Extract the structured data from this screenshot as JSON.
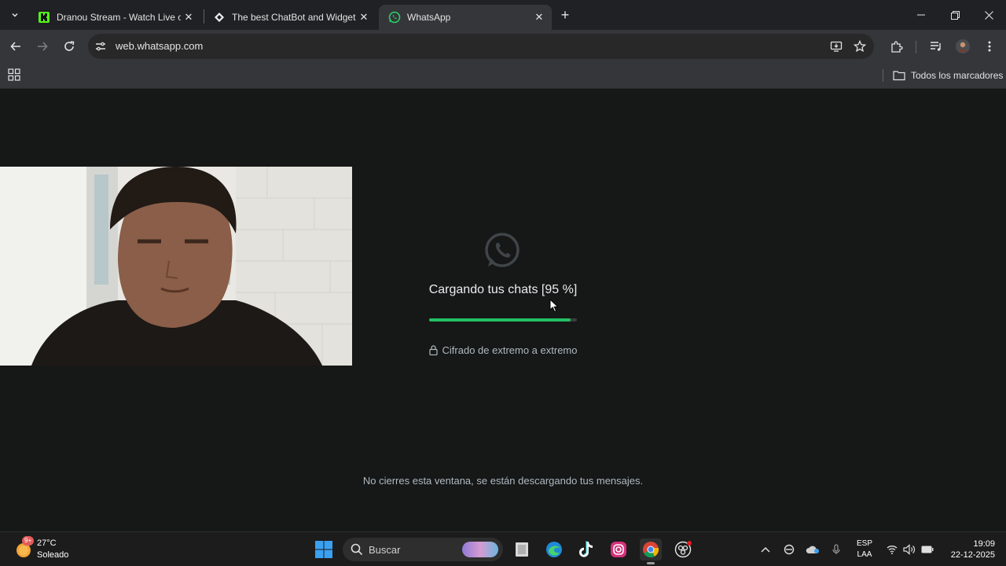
{
  "browser": {
    "tabs": [
      {
        "title": "Dranou Stream - Watch Live on",
        "favicon": "kick-logo-icon",
        "active": false
      },
      {
        "title": "The best ChatBot and Widgets",
        "favicon": "diamond-icon",
        "active": false
      },
      {
        "title": "WhatsApp",
        "favicon": "whatsapp-logo-icon",
        "active": true
      }
    ],
    "url": "web.whatsapp.com",
    "bookmarks_folder": "Todos los marcadores",
    "colors": {
      "frame": "#202124",
      "toolbar": "#35363a",
      "omnibox": "#282828"
    }
  },
  "whatsapp": {
    "loading_text": "Cargando tus chats [95 %]",
    "progress_fraction": 0.96,
    "encryption_text": "Cifrado de extremo a extremo",
    "notice_text": "No cierres esta ventana, se están descargando tus mensajes.",
    "colors": {
      "background": "#161717",
      "accent": "#21c063"
    }
  },
  "taskbar": {
    "weather_temp": "27°C",
    "weather_desc": "Soleado",
    "weather_badge": "9+",
    "search_placeholder": "Buscar",
    "apps": [
      "windows-start-icon",
      "file-explorer-icon",
      "edge-icon",
      "tiktok-icon",
      "instagram-icon",
      "chrome-icon",
      "obs-icon"
    ],
    "language_line1": "ESP",
    "language_line2": "LAA",
    "time": "19:09",
    "date": "22-12-2025"
  }
}
